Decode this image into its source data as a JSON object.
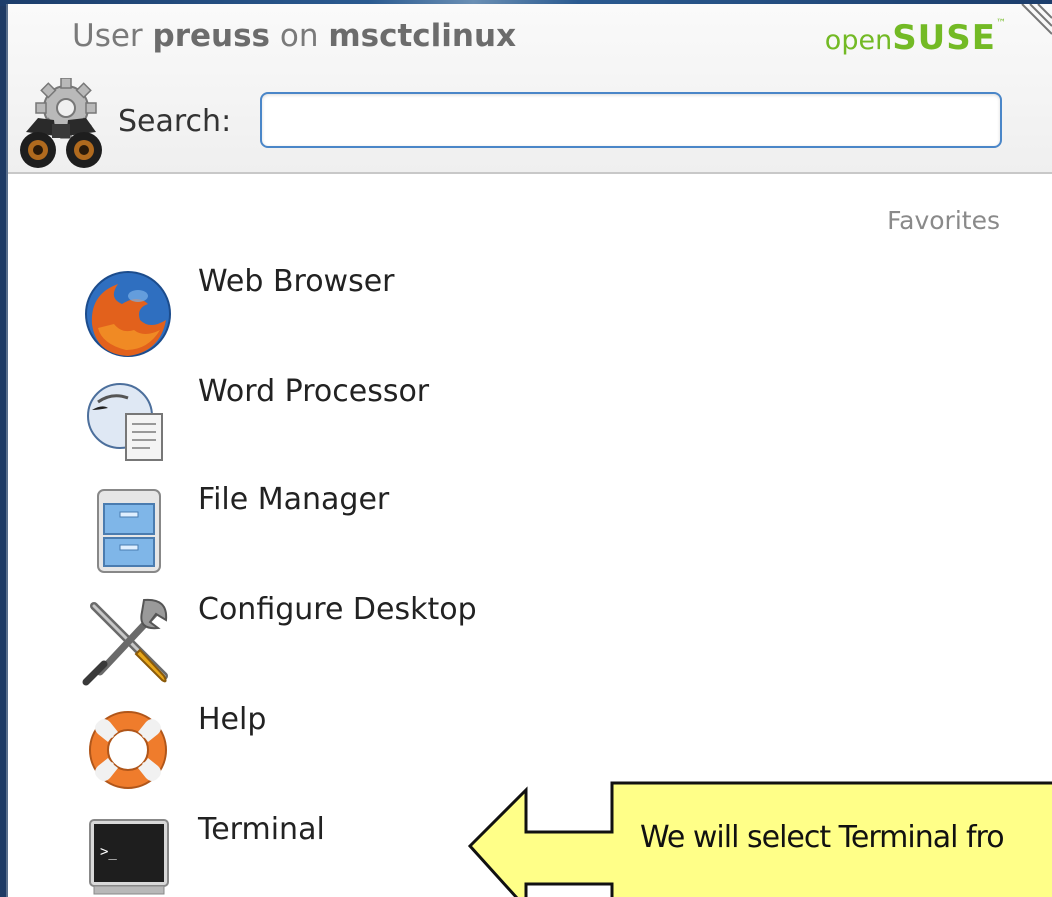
{
  "header": {
    "user_prefix": "User",
    "username": "preuss",
    "on_text": "on",
    "hostname": "msctclinux",
    "brand_open": "open",
    "brand_suse": "SUSE",
    "brand_tm": "™"
  },
  "search": {
    "label": "Search:",
    "value": "",
    "placeholder": ""
  },
  "favorites": {
    "title": "Favorites",
    "items": [
      {
        "label": "Web Browser",
        "icon": "firefox-icon"
      },
      {
        "label": "Word Processor",
        "icon": "word-processor-icon"
      },
      {
        "label": "File Manager",
        "icon": "file-manager-icon"
      },
      {
        "label": "Configure Desktop",
        "icon": "configure-desktop-icon"
      },
      {
        "label": "Help",
        "icon": "help-lifebuoy-icon"
      },
      {
        "label": "Terminal",
        "icon": "terminal-icon"
      }
    ]
  },
  "callout": {
    "text": "We will select Terminal fro"
  },
  "colors": {
    "brand_green": "#73ba25",
    "search_border": "#4a86c8",
    "callout_fill": "#ffff88"
  }
}
